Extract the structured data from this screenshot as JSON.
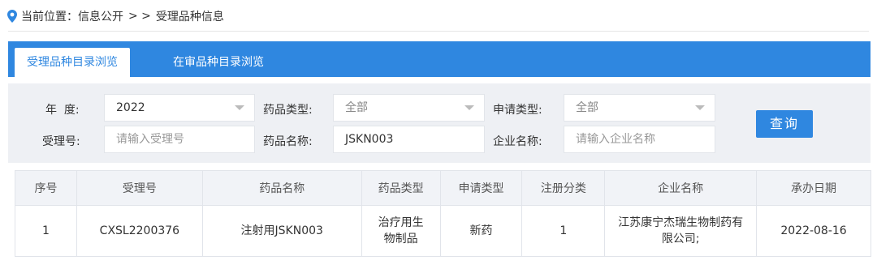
{
  "breadcrumb": {
    "prefix": "当前位置：",
    "section": "信息公开",
    "sep": "> >",
    "current": "受理品种信息"
  },
  "tabs": [
    {
      "label": "受理品种目录浏览",
      "active": true
    },
    {
      "label": "在审品种目录浏览",
      "active": false
    }
  ],
  "filter": {
    "year_label": "年  度:",
    "year_value": "2022",
    "drug_type_label": "药品类型:",
    "drug_type_value": "全部",
    "apply_type_label": "申请类型:",
    "apply_type_value": "全部",
    "accept_no_label": "受理号:",
    "accept_no_placeholder": "请输入受理号",
    "drug_name_label": "药品名称:",
    "drug_name_value": "JSKN003",
    "company_label": "企业名称:",
    "company_placeholder": "请输入企业名称",
    "query_button": "查询"
  },
  "table": {
    "headers": [
      "序号",
      "受理号",
      "药品名称",
      "药品类型",
      "申请类型",
      "注册分类",
      "企业名称",
      "承办日期"
    ],
    "rows": [
      [
        "1",
        "CXSL2200376",
        "注射用JSKN003",
        "治疗用生物制品",
        "新药",
        "1",
        "江苏康宁杰瑞生物制药有限公司;",
        "2022-08-16"
      ]
    ]
  },
  "colors": {
    "accent": "#2f87e0",
    "filter_bg": "#eef0f4"
  }
}
